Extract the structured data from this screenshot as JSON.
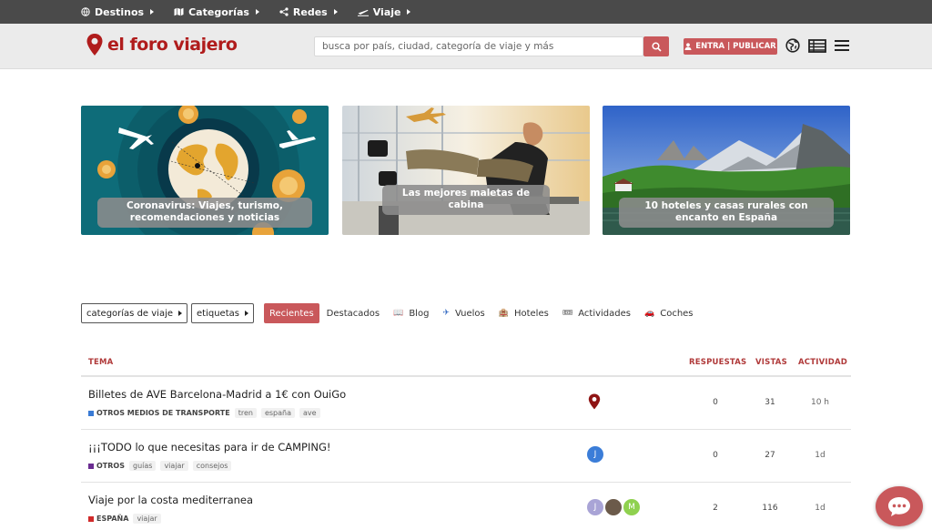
{
  "topnav": {
    "items": [
      {
        "label": "Destinos",
        "icon": "globe-icon"
      },
      {
        "label": "Categorías",
        "icon": "map-icon"
      },
      {
        "label": "Redes",
        "icon": "share-icon"
      },
      {
        "label": "Viaje",
        "icon": "plane-icon"
      }
    ]
  },
  "header": {
    "logo_text": "el foro viajero",
    "search_placeholder": "busca por país, ciudad, categoría de viaje y más",
    "login_label": "ENTRA | PUBLICAR"
  },
  "hero": [
    {
      "title": "Coronavirus: Viajes, turismo, recomendaciones y noticias"
    },
    {
      "title": "Las mejores maletas de cabina"
    },
    {
      "title": "10 hoteles y casas rurales con encanto en España"
    }
  ],
  "filters": {
    "dropdowns": [
      "categorías de viaje",
      "etiquetas"
    ],
    "active": "Recientes",
    "links": [
      {
        "label": "Destacados",
        "icon": ""
      },
      {
        "label": "Blog",
        "icon": "📖"
      },
      {
        "label": "Vuelos",
        "icon": "✈"
      },
      {
        "label": "Hoteles",
        "icon": "🏨"
      },
      {
        "label": "Actividades",
        "icon": "🎟"
      },
      {
        "label": "Coches",
        "icon": "🚗"
      }
    ]
  },
  "table": {
    "headers": {
      "topic": "TEMA",
      "replies": "RESPUESTAS",
      "views": "VISTAS",
      "activity": "ACTIVIDAD"
    },
    "rows": [
      {
        "title": "Billetes de AVE Barcelona-Madrid a 1€ con OuiGo",
        "category": "OTROS MEDIOS DE TRANSPORTE",
        "category_color": "#3a7bd5",
        "tags": [
          "tren",
          "españa",
          "ave"
        ],
        "replies": "0",
        "views": "31",
        "activity": "10 h"
      },
      {
        "title": "¡¡¡TODO lo que necesitas para ir de CAMPING!",
        "category": "OTROS",
        "category_color": "#6a2c91",
        "tags": [
          "guías",
          "viajar",
          "consejos"
        ],
        "replies": "0",
        "views": "27",
        "activity": "1d"
      },
      {
        "title": "Viaje por la costa mediterranea",
        "category": "ESPAÑA",
        "category_color": "#d02a2a",
        "tags": [
          "viajar"
        ],
        "replies": "2",
        "views": "116",
        "activity": "1d"
      }
    ]
  },
  "avatars": {
    "row2": [
      {
        "letter": "J",
        "color": "#3b7dd8"
      }
    ],
    "row3": [
      {
        "letter": "J",
        "color": "#a9a4d6"
      },
      {
        "letter": "",
        "color": "#6b5a4a"
      },
      {
        "letter": "M",
        "color": "#8fd14f"
      }
    ]
  },
  "colors": {
    "accent": "#c9585b",
    "brand": "#b01c1c",
    "topbar": "#4a4a4a"
  }
}
